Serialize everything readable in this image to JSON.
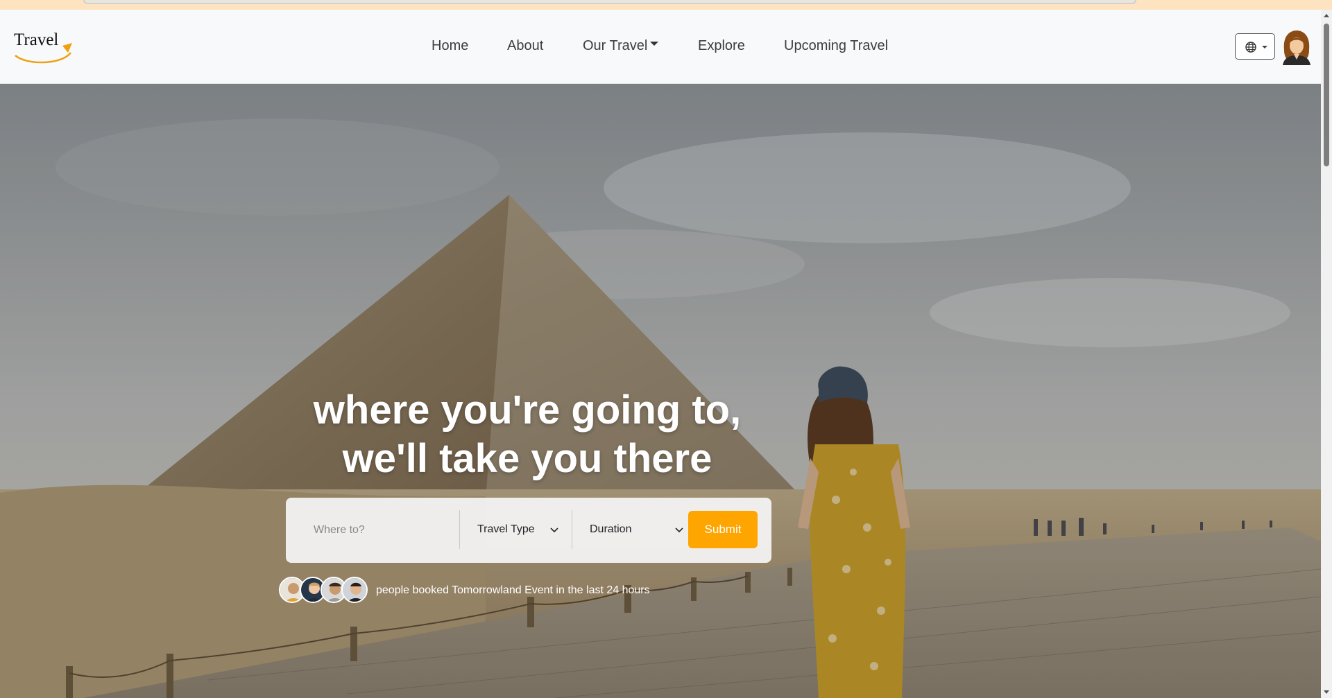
{
  "header": {
    "logo_text": "Travel",
    "nav": {
      "home": "Home",
      "about": "About",
      "our_travel": "Our Travel",
      "explore": "Explore",
      "upcoming": "Upcoming Travel"
    }
  },
  "hero": {
    "title_line1": "where you're going to,",
    "title_line2": "we'll take you there",
    "search": {
      "placeholder": "Where to?",
      "travel_type": "Travel Type",
      "duration": "Duration",
      "submit": "Submit"
    },
    "booked_text": "people booked Tomorrowland Event in the last 24 hours"
  },
  "icons": {
    "language": "globe-icon",
    "avatar": "user-avatar",
    "chevron": "chevron-down-icon"
  },
  "colors": {
    "accent": "#ffa500",
    "header_bg": "#f7f9fb",
    "nav_text": "#3d3d3d"
  }
}
